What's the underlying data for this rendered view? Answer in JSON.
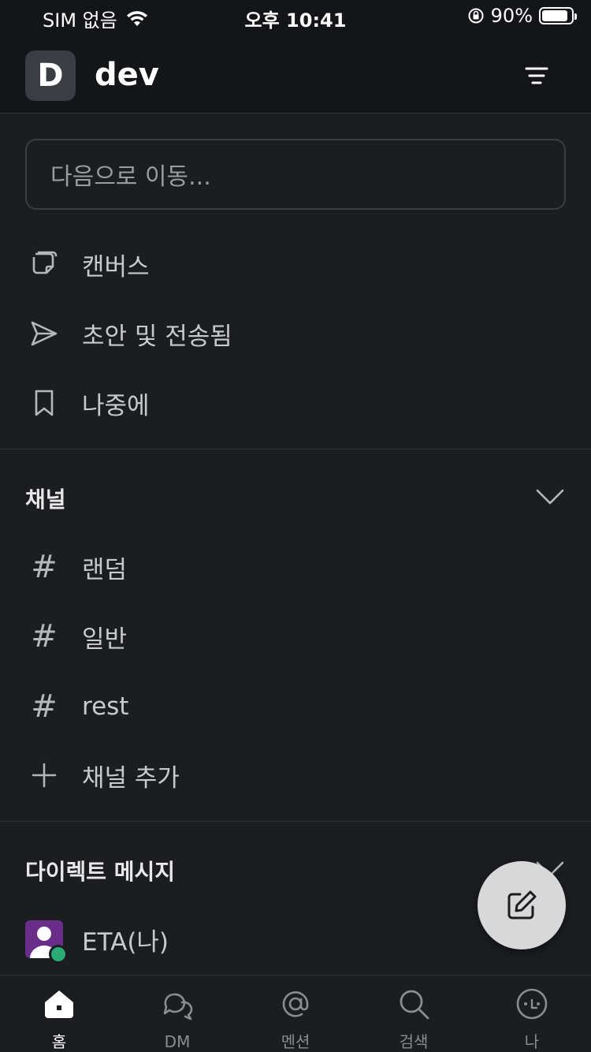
{
  "status_bar": {
    "carrier": "SIM 없음",
    "time": "오후 10:41",
    "battery_percent": "90%",
    "battery_level": 0.9
  },
  "header": {
    "workspace_initial": "D",
    "workspace_name": "dev"
  },
  "search": {
    "placeholder": "다음으로 이동..."
  },
  "quick_links": [
    {
      "label": "캔버스",
      "icon": "canvas-icon"
    },
    {
      "label": "초안 및 전송됨",
      "icon": "send-icon"
    },
    {
      "label": "나중에",
      "icon": "bookmark-icon"
    }
  ],
  "channels": {
    "title": "채널",
    "items": [
      {
        "label": "랜덤"
      },
      {
        "label": "일반"
      },
      {
        "label": "rest"
      }
    ],
    "add_label": "채널 추가"
  },
  "direct_messages": {
    "title": "다이렉트 메시지",
    "items": [
      {
        "label": "ETA(나)",
        "presence": "away"
      }
    ]
  },
  "tabbar": {
    "tabs": [
      {
        "label": "홈",
        "icon": "home-icon",
        "active": true
      },
      {
        "label": "DM",
        "icon": "dm-icon",
        "active": false
      },
      {
        "label": "멘션",
        "icon": "mention-icon",
        "active": false
      },
      {
        "label": "검색",
        "icon": "search-icon",
        "active": false
      },
      {
        "label": "나",
        "icon": "profile-icon",
        "active": false
      }
    ]
  },
  "colors": {
    "background": "#1b1d21",
    "header_background": "#141518",
    "presence_online": "#2bac76",
    "avatar": "#6a2e8a"
  }
}
